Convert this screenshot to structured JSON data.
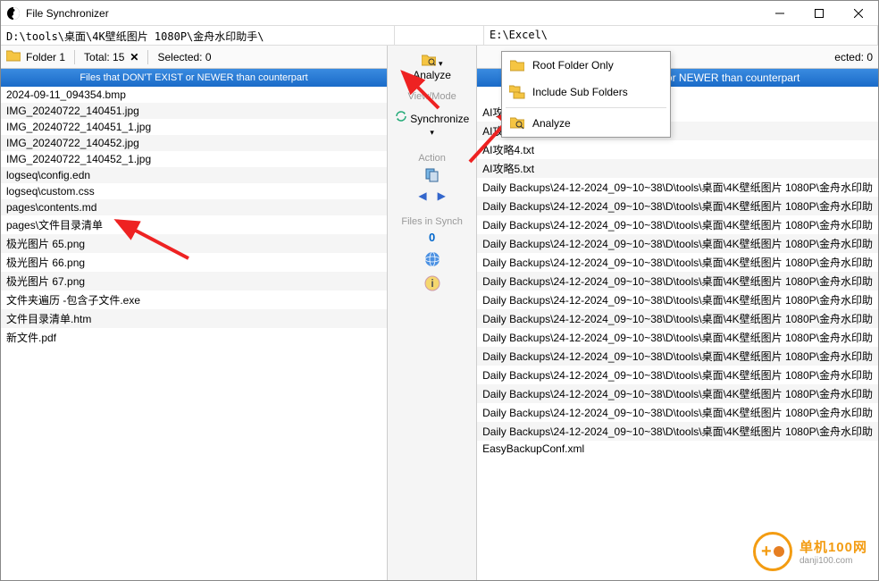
{
  "window": {
    "title": "File Synchronizer"
  },
  "paths": {
    "left": "D:\\tools\\桌面\\4K壁纸图片 1080P\\金舟水印助手\\",
    "right": "E:\\Excel\\"
  },
  "centerPanel": {
    "analyze_label": "Analyze",
    "viewmode_title": "View/Mode",
    "synchronize_label": "Synchronize",
    "action_title": "Action",
    "files_title": "Files in Synch",
    "files_count": "0"
  },
  "dropdown": {
    "root_only": "Root Folder Only",
    "include_sub": "Include Sub Folders",
    "analyze": "Analyze"
  },
  "leftPane": {
    "folder_label": "Folder 1",
    "total_label": "Total: 15",
    "selected_label": "Selected: 0",
    "header": "Files that DON'T EXIST or NEWER than counterpart",
    "files": [
      "2024-09-11_094354.bmp",
      "IMG_20240722_140451.jpg",
      "IMG_20240722_140451_1.jpg",
      "IMG_20240722_140452.jpg",
      "IMG_20240722_140452_1.jpg",
      "logseq\\config.edn",
      "logseq\\custom.css",
      "pages\\contents.md",
      "pages\\文件目录清单",
      "极光图片 65.png",
      "极光图片 66.png",
      "极光图片 67.png",
      "文件夹遍历 -包含子文件.exe",
      "文件目录清单.htm",
      "新文件.pdf"
    ]
  },
  "rightPane": {
    "selected_label": "ected: 0",
    "header_fragment": "IST or NEWER than counterpart",
    "files": [
      "AI攻略2.txt",
      "AI攻略3.txt",
      "AI攻略4.txt",
      "AI攻略5.txt",
      "Daily Backups\\24-12-2024_09~10~38\\D\\tools\\桌面\\4K壁纸图片 1080P\\金舟水印助",
      "Daily Backups\\24-12-2024_09~10~38\\D\\tools\\桌面\\4K壁纸图片 1080P\\金舟水印助",
      "Daily Backups\\24-12-2024_09~10~38\\D\\tools\\桌面\\4K壁纸图片 1080P\\金舟水印助",
      "Daily Backups\\24-12-2024_09~10~38\\D\\tools\\桌面\\4K壁纸图片 1080P\\金舟水印助",
      "Daily Backups\\24-12-2024_09~10~38\\D\\tools\\桌面\\4K壁纸图片 1080P\\金舟水印助",
      "Daily Backups\\24-12-2024_09~10~38\\D\\tools\\桌面\\4K壁纸图片 1080P\\金舟水印助",
      "Daily Backups\\24-12-2024_09~10~38\\D\\tools\\桌面\\4K壁纸图片 1080P\\金舟水印助",
      "Daily Backups\\24-12-2024_09~10~38\\D\\tools\\桌面\\4K壁纸图片 1080P\\金舟水印助",
      "Daily Backups\\24-12-2024_09~10~38\\D\\tools\\桌面\\4K壁纸图片 1080P\\金舟水印助",
      "Daily Backups\\24-12-2024_09~10~38\\D\\tools\\桌面\\4K壁纸图片 1080P\\金舟水印助",
      "Daily Backups\\24-12-2024_09~10~38\\D\\tools\\桌面\\4K壁纸图片 1080P\\金舟水印助",
      "Daily Backups\\24-12-2024_09~10~38\\D\\tools\\桌面\\4K壁纸图片 1080P\\金舟水印助",
      "Daily Backups\\24-12-2024_09~10~38\\D\\tools\\桌面\\4K壁纸图片 1080P\\金舟水印助",
      "Daily Backups\\24-12-2024_09~10~38\\D\\tools\\桌面\\4K壁纸图片 1080P\\金舟水印助",
      "EasyBackupConf.xml"
    ]
  },
  "watermark": {
    "cn": "单机100网",
    "en": "danji100.com"
  }
}
